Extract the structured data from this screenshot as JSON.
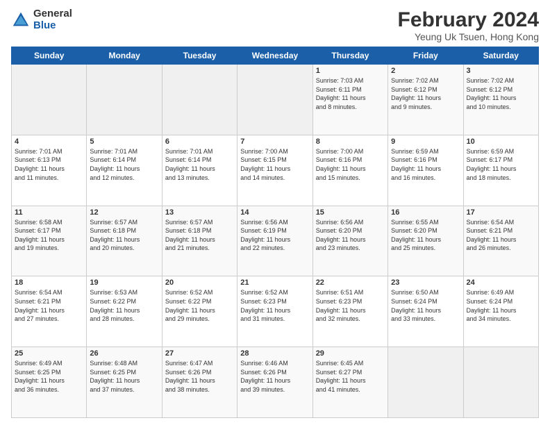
{
  "header": {
    "logo_general": "General",
    "logo_blue": "Blue",
    "month_year": "February 2024",
    "location": "Yeung Uk Tsuen, Hong Kong"
  },
  "weekdays": [
    "Sunday",
    "Monday",
    "Tuesday",
    "Wednesday",
    "Thursday",
    "Friday",
    "Saturday"
  ],
  "weeks": [
    [
      {
        "day": "",
        "info": ""
      },
      {
        "day": "",
        "info": ""
      },
      {
        "day": "",
        "info": ""
      },
      {
        "day": "",
        "info": ""
      },
      {
        "day": "1",
        "info": "Sunrise: 7:03 AM\nSunset: 6:11 PM\nDaylight: 11 hours\nand 8 minutes."
      },
      {
        "day": "2",
        "info": "Sunrise: 7:02 AM\nSunset: 6:12 PM\nDaylight: 11 hours\nand 9 minutes."
      },
      {
        "day": "3",
        "info": "Sunrise: 7:02 AM\nSunset: 6:12 PM\nDaylight: 11 hours\nand 10 minutes."
      }
    ],
    [
      {
        "day": "4",
        "info": "Sunrise: 7:01 AM\nSunset: 6:13 PM\nDaylight: 11 hours\nand 11 minutes."
      },
      {
        "day": "5",
        "info": "Sunrise: 7:01 AM\nSunset: 6:14 PM\nDaylight: 11 hours\nand 12 minutes."
      },
      {
        "day": "6",
        "info": "Sunrise: 7:01 AM\nSunset: 6:14 PM\nDaylight: 11 hours\nand 13 minutes."
      },
      {
        "day": "7",
        "info": "Sunrise: 7:00 AM\nSunset: 6:15 PM\nDaylight: 11 hours\nand 14 minutes."
      },
      {
        "day": "8",
        "info": "Sunrise: 7:00 AM\nSunset: 6:16 PM\nDaylight: 11 hours\nand 15 minutes."
      },
      {
        "day": "9",
        "info": "Sunrise: 6:59 AM\nSunset: 6:16 PM\nDaylight: 11 hours\nand 16 minutes."
      },
      {
        "day": "10",
        "info": "Sunrise: 6:59 AM\nSunset: 6:17 PM\nDaylight: 11 hours\nand 18 minutes."
      }
    ],
    [
      {
        "day": "11",
        "info": "Sunrise: 6:58 AM\nSunset: 6:17 PM\nDaylight: 11 hours\nand 19 minutes."
      },
      {
        "day": "12",
        "info": "Sunrise: 6:57 AM\nSunset: 6:18 PM\nDaylight: 11 hours\nand 20 minutes."
      },
      {
        "day": "13",
        "info": "Sunrise: 6:57 AM\nSunset: 6:18 PM\nDaylight: 11 hours\nand 21 minutes."
      },
      {
        "day": "14",
        "info": "Sunrise: 6:56 AM\nSunset: 6:19 PM\nDaylight: 11 hours\nand 22 minutes."
      },
      {
        "day": "15",
        "info": "Sunrise: 6:56 AM\nSunset: 6:20 PM\nDaylight: 11 hours\nand 23 minutes."
      },
      {
        "day": "16",
        "info": "Sunrise: 6:55 AM\nSunset: 6:20 PM\nDaylight: 11 hours\nand 25 minutes."
      },
      {
        "day": "17",
        "info": "Sunrise: 6:54 AM\nSunset: 6:21 PM\nDaylight: 11 hours\nand 26 minutes."
      }
    ],
    [
      {
        "day": "18",
        "info": "Sunrise: 6:54 AM\nSunset: 6:21 PM\nDaylight: 11 hours\nand 27 minutes."
      },
      {
        "day": "19",
        "info": "Sunrise: 6:53 AM\nSunset: 6:22 PM\nDaylight: 11 hours\nand 28 minutes."
      },
      {
        "day": "20",
        "info": "Sunrise: 6:52 AM\nSunset: 6:22 PM\nDaylight: 11 hours\nand 29 minutes."
      },
      {
        "day": "21",
        "info": "Sunrise: 6:52 AM\nSunset: 6:23 PM\nDaylight: 11 hours\nand 31 minutes."
      },
      {
        "day": "22",
        "info": "Sunrise: 6:51 AM\nSunset: 6:23 PM\nDaylight: 11 hours\nand 32 minutes."
      },
      {
        "day": "23",
        "info": "Sunrise: 6:50 AM\nSunset: 6:24 PM\nDaylight: 11 hours\nand 33 minutes."
      },
      {
        "day": "24",
        "info": "Sunrise: 6:49 AM\nSunset: 6:24 PM\nDaylight: 11 hours\nand 34 minutes."
      }
    ],
    [
      {
        "day": "25",
        "info": "Sunrise: 6:49 AM\nSunset: 6:25 PM\nDaylight: 11 hours\nand 36 minutes."
      },
      {
        "day": "26",
        "info": "Sunrise: 6:48 AM\nSunset: 6:25 PM\nDaylight: 11 hours\nand 37 minutes."
      },
      {
        "day": "27",
        "info": "Sunrise: 6:47 AM\nSunset: 6:26 PM\nDaylight: 11 hours\nand 38 minutes."
      },
      {
        "day": "28",
        "info": "Sunrise: 6:46 AM\nSunset: 6:26 PM\nDaylight: 11 hours\nand 39 minutes."
      },
      {
        "day": "29",
        "info": "Sunrise: 6:45 AM\nSunset: 6:27 PM\nDaylight: 11 hours\nand 41 minutes."
      },
      {
        "day": "",
        "info": ""
      },
      {
        "day": "",
        "info": ""
      }
    ]
  ]
}
